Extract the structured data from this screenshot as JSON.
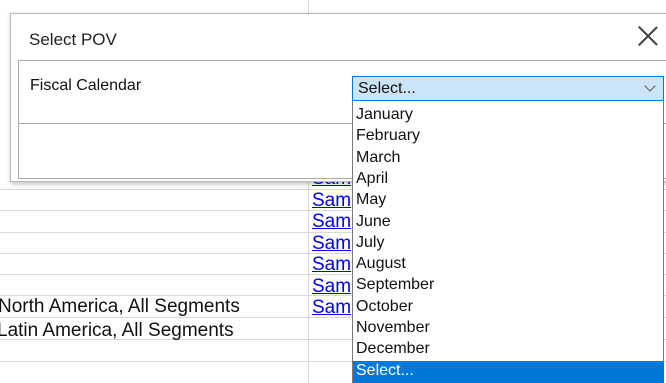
{
  "dialog": {
    "title": "Select POV",
    "field_label": "Fiscal Calendar",
    "select_value": "Select..."
  },
  "dropdown": {
    "options": [
      "January",
      "February",
      "March",
      "April",
      "May",
      "June",
      "July",
      "August",
      "September",
      "October",
      "November",
      "December",
      "Select..."
    ],
    "selected_index": 12
  },
  "sheet": {
    "links": [
      "Sam",
      "Sam",
      "Sam",
      "Sam",
      "Sam",
      "Sam",
      "Sam"
    ],
    "regions": [
      "North America, All Segments",
      "Latin America, All Segments"
    ]
  },
  "colors": {
    "select_bg": "#cce4f7",
    "accent": "#0078d7",
    "link": "#0000ee"
  }
}
